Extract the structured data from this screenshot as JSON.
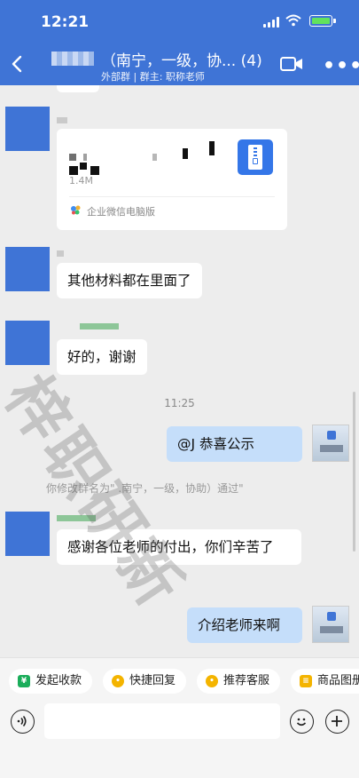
{
  "status": {
    "time": "12:21"
  },
  "header": {
    "title": "（南宁，一级，协... (4)",
    "subtitle": "外部群  |  群主: 职称老师"
  },
  "messages": {
    "file_size": "1.4M",
    "file_source": "企业微信电脑版",
    "msg1": "其他材料都在里面了",
    "msg2": "好的，谢谢",
    "time1": "11:25",
    "msg3_mine": "@J    恭喜公示",
    "sys_note": "你修改群名为\"         .南宁，一级，协助）通过\"",
    "msg4": "感谢各位老师的付出，你们辛苦了",
    "msg5_mine": "介绍老师来啊"
  },
  "watermark": "梓职研新",
  "quickbar": {
    "items": [
      "发起收款",
      "快捷回复",
      "推荐客服",
      "商品图册"
    ],
    "icon_glyphs": [
      "¥",
      "•",
      "•",
      "≡"
    ]
  },
  "input": {
    "placeholder": ""
  },
  "colors": {
    "header": "#3f74d6",
    "my_bubble": "#c5defa",
    "avatar": "#3f74d6"
  }
}
